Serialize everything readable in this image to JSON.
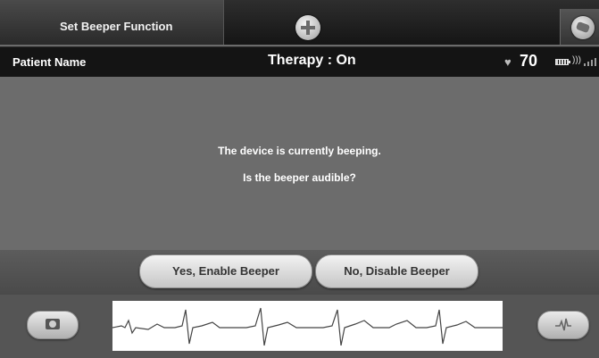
{
  "header": {
    "title": "Set Beeper Function",
    "menu_icon": "plus-circle-icon",
    "corner_icon": "programmer-wand-icon"
  },
  "status": {
    "patient_label": "Patient Name",
    "therapy": "Therapy : On",
    "heart_icon": "heart-icon",
    "heart_rate": "70",
    "battery_icon": "battery-icon",
    "wifi_icon": "wifi-icon",
    "signal_icon": "signal-bars-icon"
  },
  "main": {
    "message_line1": "The device is currently beeping.",
    "message_line2": "Is the beeper audible?"
  },
  "actions": {
    "yes_label": "Yes, Enable Beeper",
    "no_label": "No, Disable Beeper"
  },
  "ecg": {
    "snapshot_icon": "camera-icon",
    "marker_icon": "pulse-marker-icon"
  },
  "colors": {
    "background": "#6c6c6c",
    "topbar": "#222222",
    "statusbar": "#141414",
    "button": "#e0e0e0"
  }
}
